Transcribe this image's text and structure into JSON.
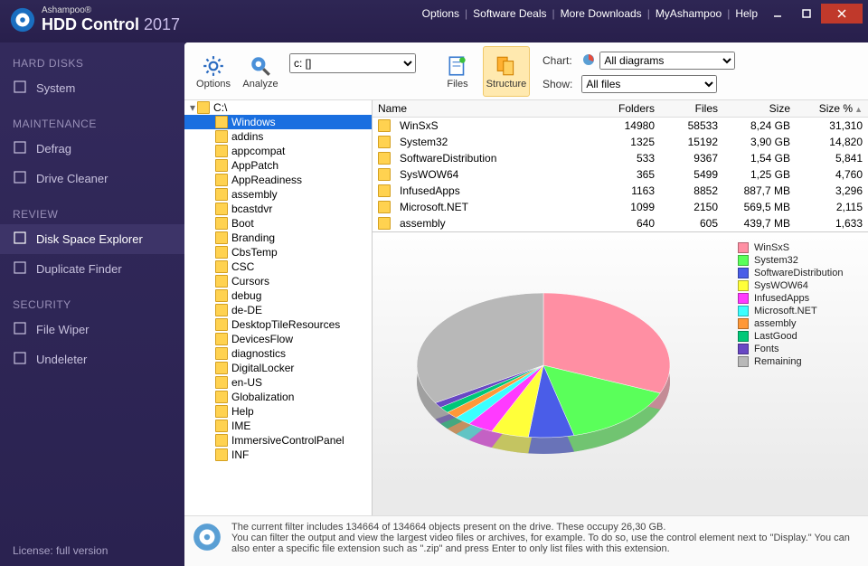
{
  "title": {
    "brand": "Ashampoo®",
    "product": "HDD Control",
    "year": "2017"
  },
  "menu": [
    "Options",
    "Software Deals",
    "More Downloads",
    "MyAshampoo",
    "Help"
  ],
  "sidebar": {
    "sections": [
      {
        "title": "HARD DISKS",
        "items": [
          {
            "label": "System",
            "icon": "monitor-icon"
          }
        ]
      },
      {
        "title": "MAINTENANCE",
        "items": [
          {
            "label": "Defrag",
            "icon": "grid-icon"
          },
          {
            "label": "Drive Cleaner",
            "icon": "broom-icon"
          }
        ]
      },
      {
        "title": "REVIEW",
        "items": [
          {
            "label": "Disk Space Explorer",
            "icon": "pie-icon",
            "active": true
          },
          {
            "label": "Duplicate Finder",
            "icon": "copy-icon"
          }
        ]
      },
      {
        "title": "SECURITY",
        "items": [
          {
            "label": "File Wiper",
            "icon": "shred-icon"
          },
          {
            "label": "Undeleter",
            "icon": "undo-icon"
          }
        ]
      }
    ],
    "footer": "License: full version"
  },
  "toolbar": {
    "options": "Options",
    "analyze": "Analyze",
    "files": "Files",
    "structure": "Structure",
    "drive_options": [
      "c: []"
    ],
    "drive_selected": "c: []",
    "chart_label": "Chart:",
    "show_label": "Show:",
    "chart_options": [
      "All diagrams"
    ],
    "chart_selected": "All diagrams",
    "show_options": [
      "All files"
    ],
    "show_selected": "All files"
  },
  "tree": {
    "root": "C:\\",
    "selected": "Windows",
    "children": [
      "Windows",
      "addins",
      "appcompat",
      "AppPatch",
      "AppReadiness",
      "assembly",
      "bcastdvr",
      "Boot",
      "Branding",
      "CbsTemp",
      "CSC",
      "Cursors",
      "debug",
      "de-DE",
      "DesktopTileResources",
      "DevicesFlow",
      "diagnostics",
      "DigitalLocker",
      "en-US",
      "Globalization",
      "Help",
      "IME",
      "ImmersiveControlPanel",
      "INF"
    ]
  },
  "list": {
    "headers": {
      "name": "Name",
      "folders": "Folders",
      "files": "Files",
      "size": "Size",
      "pct": "Size %"
    },
    "rows": [
      {
        "name": "WinSxS",
        "folders": "14980",
        "files": "58533",
        "size": "8,24 GB",
        "pct": "31,310"
      },
      {
        "name": "System32",
        "folders": "1325",
        "files": "15192",
        "size": "3,90 GB",
        "pct": "14,820"
      },
      {
        "name": "SoftwareDistribution",
        "folders": "533",
        "files": "9367",
        "size": "1,54 GB",
        "pct": "5,841"
      },
      {
        "name": "SysWOW64",
        "folders": "365",
        "files": "5499",
        "size": "1,25 GB",
        "pct": "4,760"
      },
      {
        "name": "InfusedApps",
        "folders": "1163",
        "files": "8852",
        "size": "887,7 MB",
        "pct": "3,296"
      },
      {
        "name": "Microsoft.NET",
        "folders": "1099",
        "files": "2150",
        "size": "569,5 MB",
        "pct": "2,115"
      },
      {
        "name": "assembly",
        "folders": "640",
        "files": "605",
        "size": "439,7 MB",
        "pct": "1,633"
      }
    ]
  },
  "chart_data": {
    "type": "pie",
    "title": "",
    "series": [
      {
        "name": "WinSxS",
        "value": 31.3,
        "color": "#ff8fa3"
      },
      {
        "name": "System32",
        "value": 14.8,
        "color": "#5aff5a"
      },
      {
        "name": "SoftwareDistribution",
        "value": 5.8,
        "color": "#4a5de8"
      },
      {
        "name": "SysWOW64",
        "value": 4.8,
        "color": "#ffff3a"
      },
      {
        "name": "InfusedApps",
        "value": 3.3,
        "color": "#ff3aff"
      },
      {
        "name": "Microsoft.NET",
        "value": 2.1,
        "color": "#3affff"
      },
      {
        "name": "assembly",
        "value": 1.6,
        "color": "#ff9838"
      },
      {
        "name": "LastGood",
        "value": 1.4,
        "color": "#00c878"
      },
      {
        "name": "Fonts",
        "value": 1.2,
        "color": "#6847c4"
      },
      {
        "name": "Remaining",
        "value": 33.7,
        "color": "#b8b8b8"
      }
    ]
  },
  "status": {
    "line1": "The current filter includes 134664 of 134664 objects present on the drive. These occupy 26,30 GB.",
    "line2": "You can filter the output and view the largest video files or archives, for example. To do so, use the control element next to \"Display.\" You can also enter a specific file extension such as \".zip\" and press Enter to only list files with this extension."
  }
}
